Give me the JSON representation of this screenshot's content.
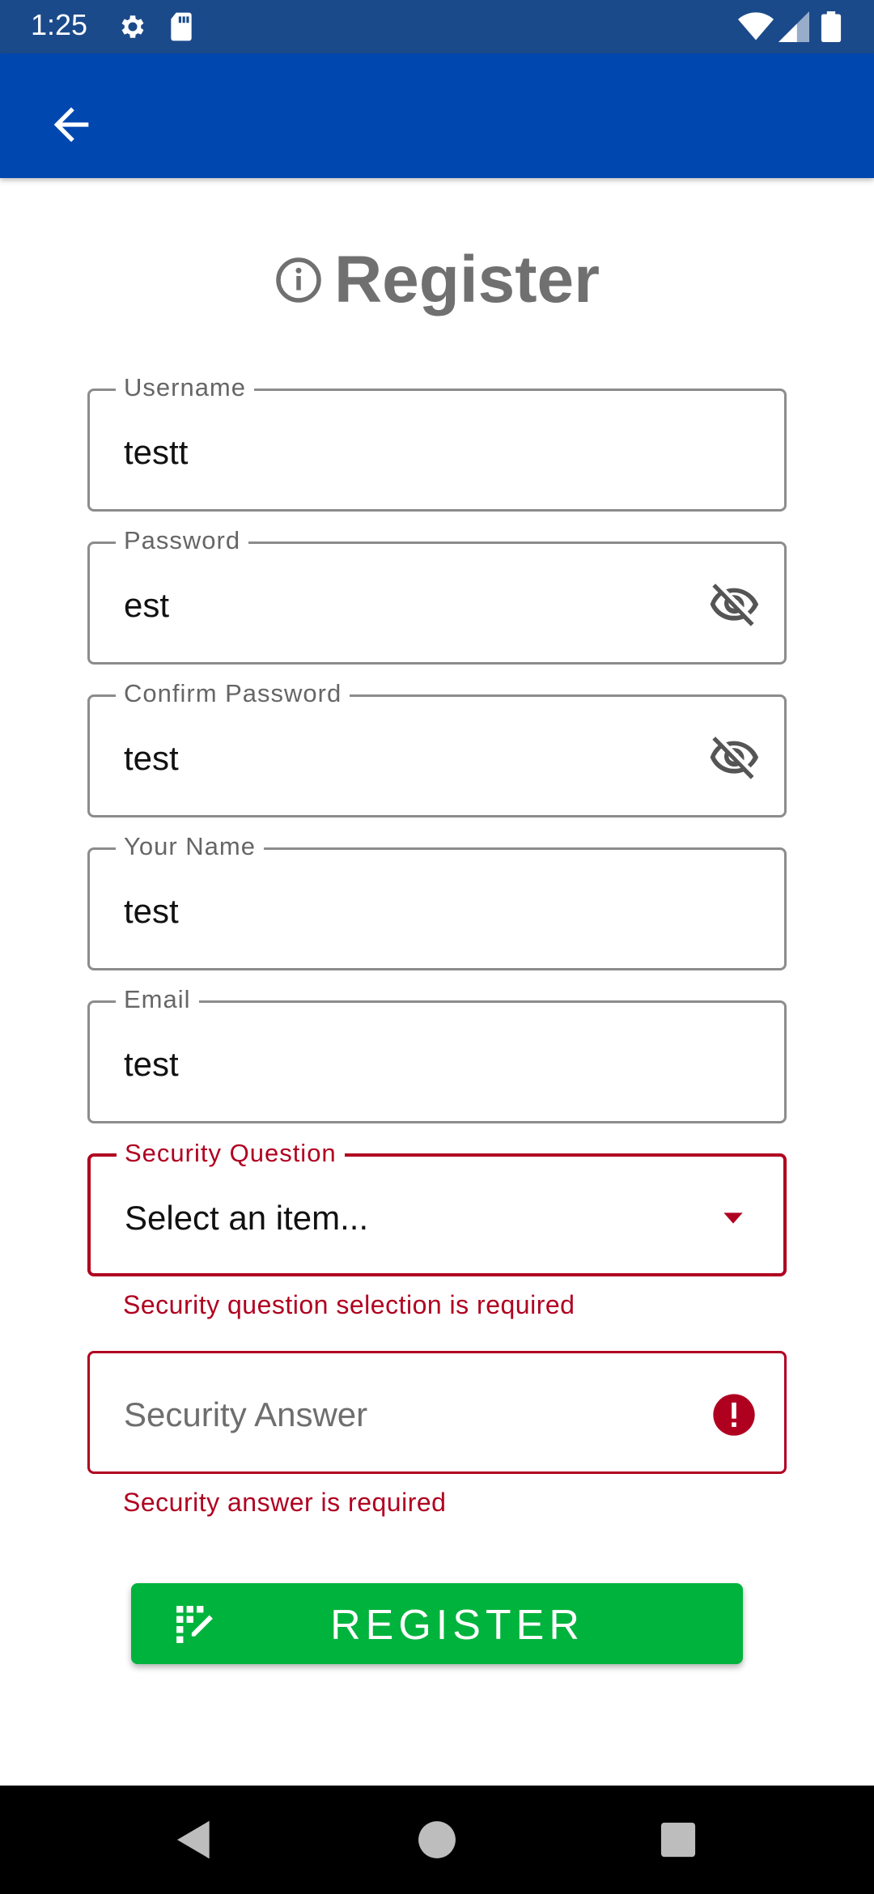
{
  "status_bar": {
    "time": "1:25",
    "icons": [
      "gear-icon",
      "sd-card-icon",
      "wifi-icon",
      "signal-icon",
      "battery-icon"
    ]
  },
  "app_bar": {
    "back_icon": "arrow-left-icon"
  },
  "page": {
    "title": "Register",
    "title_icon": "info-circle-icon"
  },
  "form": {
    "username": {
      "label": "Username",
      "value": "testt"
    },
    "password": {
      "label": "Password",
      "value": "est",
      "toggle_icon": "eye-off-icon"
    },
    "confirm_password": {
      "label": "Confirm Password",
      "value": "test",
      "toggle_icon": "eye-off-icon"
    },
    "your_name": {
      "label": "Your Name",
      "value": "test"
    },
    "email": {
      "label": "Email",
      "value": "test"
    },
    "security_question": {
      "label": "Security Question",
      "value": "Select an item...",
      "error": "Security question selection is required"
    },
    "security_answer": {
      "placeholder": "Security Answer",
      "error": "Security answer is required"
    }
  },
  "register_button": {
    "label": "REGISTER",
    "icon": "draw-icon"
  },
  "colors": {
    "app_bar": "#0047b0",
    "status_bar": "#1b4a8a",
    "error": "#b00020",
    "register": "#00b33c",
    "title": "#707070"
  }
}
